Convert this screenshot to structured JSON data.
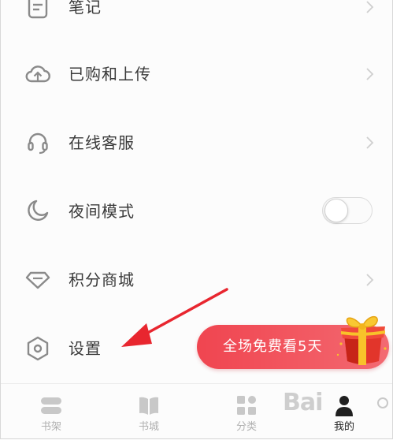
{
  "menu": {
    "items": [
      {
        "label": "笔记",
        "icon": "note-icon",
        "trailing": "chevron"
      },
      {
        "label": "已购和上传",
        "icon": "cloud-upload-icon",
        "trailing": "chevron"
      },
      {
        "label": "在线客服",
        "icon": "headset-icon",
        "trailing": "chevron"
      },
      {
        "label": "夜间模式",
        "icon": "moon-icon",
        "trailing": "toggle",
        "toggle_on": false
      },
      {
        "label": "积分商城",
        "icon": "gem-icon",
        "trailing": "chevron"
      },
      {
        "label": "设置",
        "icon": "hexagon-settings-icon",
        "trailing": "none"
      }
    ]
  },
  "promo": {
    "text": "全场免费看5天",
    "icon": "gift-box-icon"
  },
  "tabbar": {
    "tabs": [
      {
        "label": "书架",
        "icon": "bookshelf-icon",
        "active": false
      },
      {
        "label": "书城",
        "icon": "book-open-icon",
        "active": false
      },
      {
        "label": "分类",
        "icon": "category-grid-icon",
        "active": false
      },
      {
        "label": "我的",
        "icon": "user-icon",
        "active": true
      }
    ]
  },
  "watermark": {
    "text": "Bai"
  },
  "colors": {
    "background": "#fcfcfc",
    "promo_red": "#f04550",
    "annotation_arrow": "#e8262f",
    "icon_gray": "#8a8a8a",
    "tab_inactive": "#b0b0b0"
  }
}
